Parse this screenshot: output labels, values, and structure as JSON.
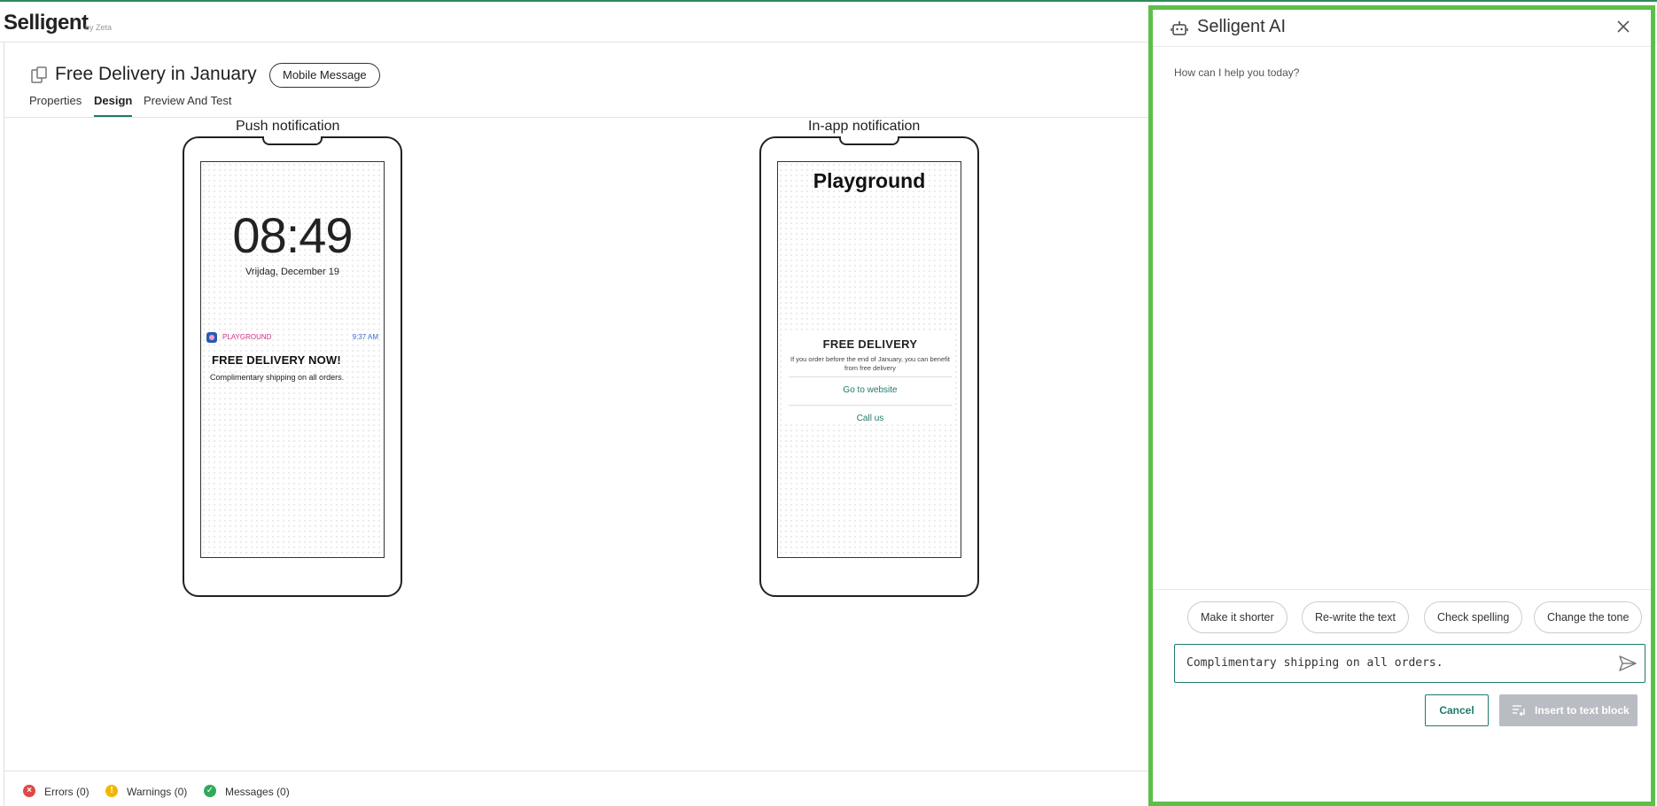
{
  "app": {
    "brand": "Selligent",
    "brand_sub": "by Zeta"
  },
  "header": {
    "title": "Free Delivery in January",
    "type_badge": "Mobile Message"
  },
  "tabs": [
    {
      "label": "Properties",
      "active": false
    },
    {
      "label": "Design",
      "active": true
    },
    {
      "label": "Preview And Test",
      "active": false
    }
  ],
  "push": {
    "label": "Push notification",
    "clock": "08:49",
    "date": "Vrijdag, December 19",
    "notification": {
      "app_name": "PLAYGROUND",
      "time": "9:37 AM",
      "title": "FREE DELIVERY NOW!",
      "body": "Complimentary shipping on all orders."
    }
  },
  "inapp": {
    "label": "In-app notification",
    "title": "Playground",
    "headline": "FREE DELIVERY",
    "text": "If you order before the end of January, you can benefit from free delivery",
    "buttons": [
      "Go to website",
      "Call us"
    ]
  },
  "status": {
    "errors": "Errors (0)",
    "warnings": "Warnings (0)",
    "messages": "Messages (0)",
    "colors": {
      "error": "#e04848",
      "warning": "#f2b705",
      "ok": "#2faa5b"
    }
  },
  "ai_panel": {
    "title": "Selligent AI",
    "greeting": "How can I help you today?",
    "chips": [
      "Make it shorter",
      "Re-write the text",
      "Check spelling",
      "Change the tone"
    ],
    "input_value": "Complimentary shipping on all orders.",
    "cancel_label": "Cancel",
    "insert_label": "Insert to text block",
    "border_color": "#5cbf4a",
    "accent_color": "#1f7a6d"
  }
}
